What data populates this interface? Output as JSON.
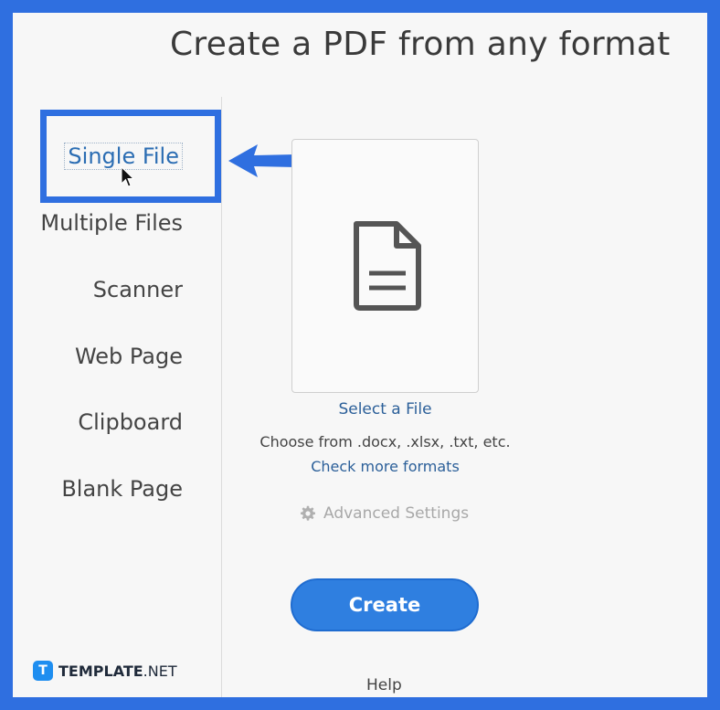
{
  "header": {
    "title": "Create a PDF from any format"
  },
  "sidebar": {
    "items": [
      {
        "label": "Single File",
        "selected": true
      },
      {
        "label": "Multiple Files"
      },
      {
        "label": "Scanner"
      },
      {
        "label": "Web Page"
      },
      {
        "label": "Clipboard"
      },
      {
        "label": "Blank Page"
      }
    ]
  },
  "main": {
    "select_file": "Select a File",
    "choose_text": "Choose from .docx, .xlsx, .txt, etc.",
    "check_formats": "Check more formats",
    "advanced_settings": "Advanced Settings",
    "create_label": "Create",
    "help_label": "Help"
  },
  "brand": {
    "logo_letter": "T",
    "name_bold": "TEMPLATE",
    "name_rest": ".NET"
  },
  "colors": {
    "accent": "#2f6fe0",
    "button": "#2f7fe0",
    "link": "#2b5f99"
  },
  "icons": {
    "file": "document-icon",
    "gear": "gear-icon",
    "arrow": "arrow-left-icon",
    "cursor": "mouse-pointer-icon"
  }
}
